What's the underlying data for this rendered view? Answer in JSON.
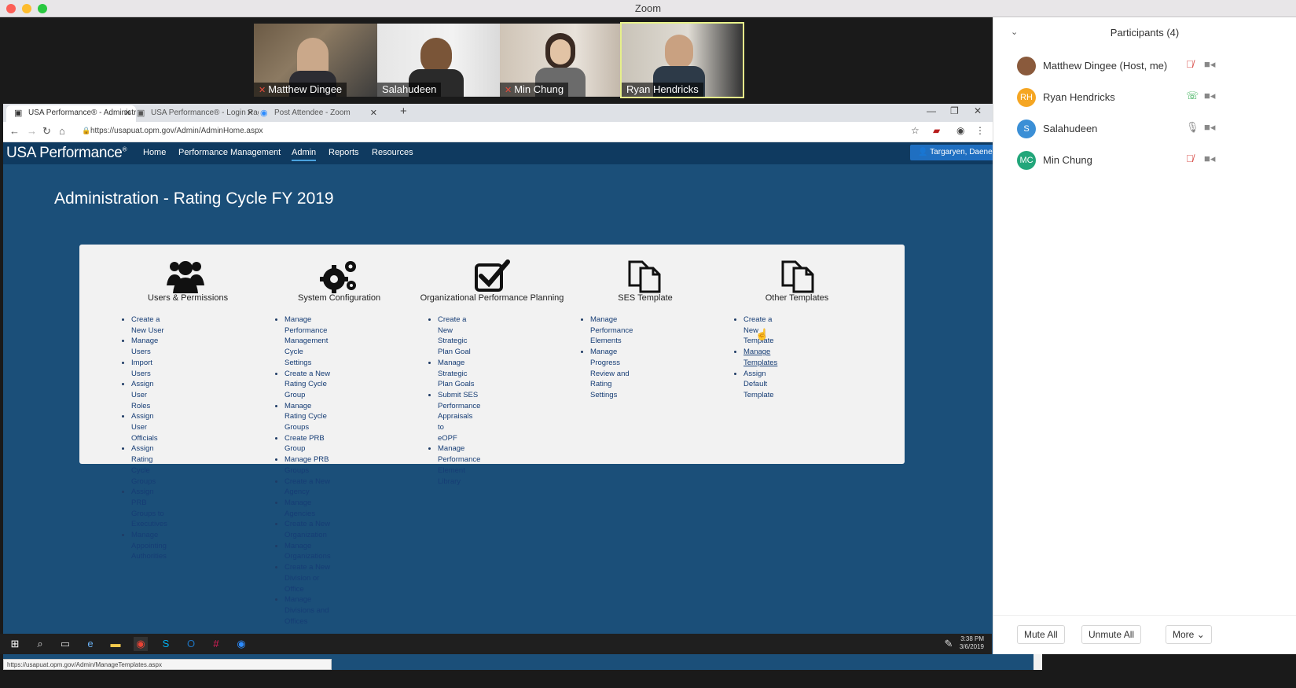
{
  "app": {
    "window_title": "Zoom"
  },
  "videos": [
    {
      "name": "Matthew Dingee",
      "muted": true
    },
    {
      "name": "Salahudeen",
      "muted": false
    },
    {
      "name": "Min Chung",
      "muted": true
    },
    {
      "name": "Ryan Hendricks",
      "muted": false
    }
  ],
  "browser": {
    "tabs": [
      {
        "label": "USA Performance® - Administra"
      },
      {
        "label": "USA Performance® - Login Page"
      },
      {
        "label": "Post Attendee - Zoom"
      }
    ],
    "url": "https://usapuat.opm.gov/Admin/AdminHome.aspx",
    "status_url": "https://usapuat.opm.gov/Admin/ManageTemplates.aspx"
  },
  "site": {
    "brand": "USA Performance",
    "brand_mark": "®",
    "nav": [
      "Home",
      "Performance Management",
      "Admin",
      "Reports",
      "Resources"
    ],
    "user_button": "Targaryen, Daenerys",
    "heading": "Administration - Rating Cycle FY 2019"
  },
  "columns": [
    {
      "title": "Users & Permissions",
      "icon": "users-icon",
      "links": [
        "Create a New User",
        "Manage Users",
        "Import Users",
        "Assign User Roles",
        "Assign User Officials",
        "Assign Rating Cycle Groups",
        "Assign PRB Groups to Executives",
        "Manage Appointing Authorities"
      ]
    },
    {
      "title": "System Configuration",
      "icon": "gears-icon",
      "links": [
        "Manage Performance Management",
        "Cycle Settings",
        "Create a New Rating Cycle Group",
        "Manage Rating Cycle Groups",
        "Create PRB Group",
        "Manage PRB Groups",
        "Create a New Agency",
        "Manage Agencies",
        "Create a New Organization",
        "Manage Organizations",
        "Create a New Division or Office",
        "Manage Divisions and Offices"
      ]
    },
    {
      "title": "Organizational Performance Planning",
      "icon": "checkbox-icon",
      "links": [
        "Create a New Strategic Plan Goal",
        "Manage Strategic Plan Goals",
        "Submit SES Performance Appraisals to",
        "eOPF",
        "Manage Performance Element Library"
      ]
    },
    {
      "title": "SES Template",
      "icon": "documents-icon",
      "links": [
        "Manage Performance Elements",
        "Manage Progress Review and Rating",
        "Settings"
      ]
    },
    {
      "title": "Other Templates",
      "icon": "documents-icon",
      "links": [
        "Create a New Template",
        "Manage Templates",
        "Assign Default Template"
      ]
    }
  ],
  "taskbar": {
    "time": "3:38 PM",
    "date": "3/6/2019"
  },
  "participants": {
    "header": "Participants (4)",
    "list": [
      {
        "name": "Matthew Dingee (Host, me)",
        "initials": "",
        "color": "#8a5a3c",
        "audio": "muted"
      },
      {
        "name": "Ryan Hendricks",
        "initials": "RH",
        "color": "#f5a623",
        "audio": "phone"
      },
      {
        "name": "Salahudeen",
        "initials": "S",
        "color": "#3b8fd6",
        "audio": "on"
      },
      {
        "name": "Min Chung",
        "initials": "MC",
        "color": "#22a67a",
        "audio": "muted"
      }
    ],
    "buttons": [
      "Mute All",
      "Unmute All",
      "More"
    ]
  }
}
